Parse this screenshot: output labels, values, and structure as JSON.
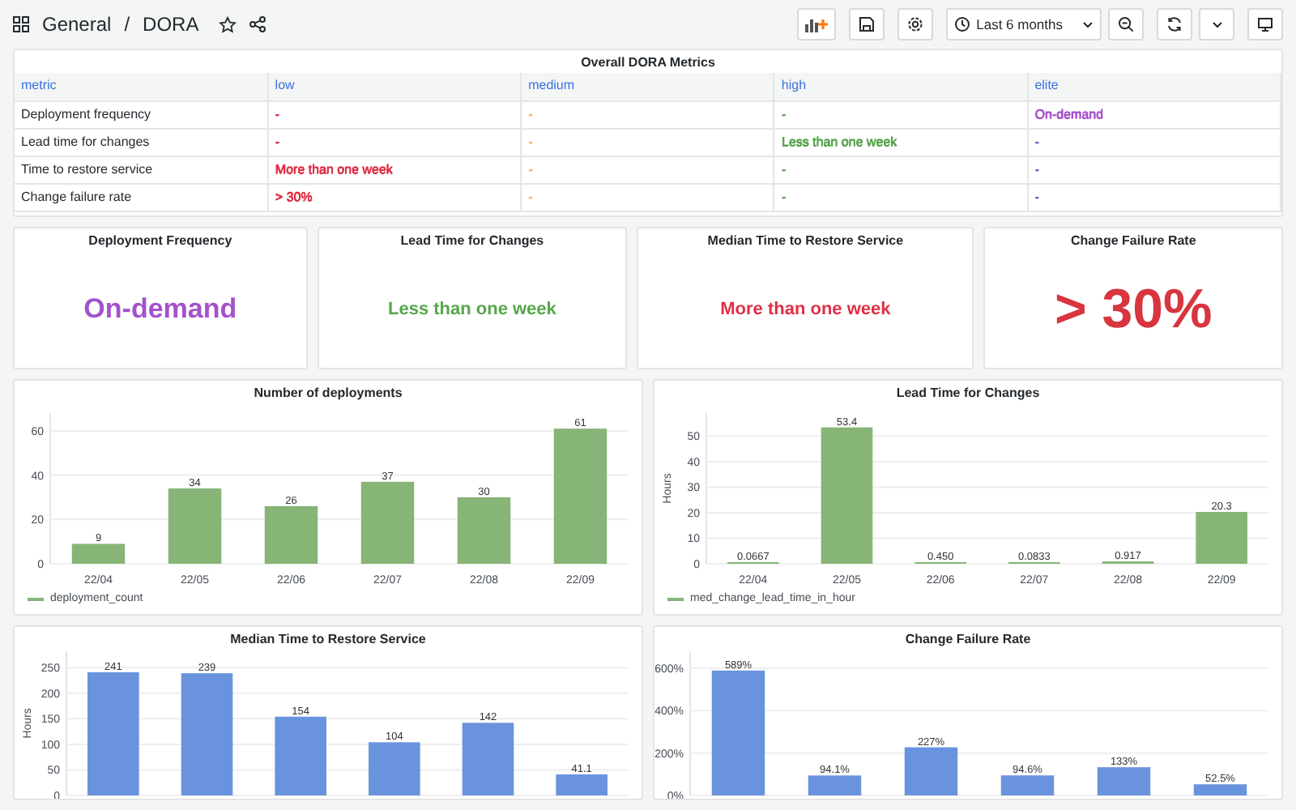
{
  "breadcrumb": {
    "folder": "General",
    "separator": "/",
    "dashboard": "DORA"
  },
  "toolbar": {
    "time_range": "Last 6 months"
  },
  "table_panel": {
    "title": "Overall DORA Metrics",
    "columns": [
      "metric",
      "low",
      "medium",
      "high",
      "elite"
    ],
    "rows": [
      {
        "cells": [
          {
            "text": "Deployment frequency"
          },
          {
            "text": "-",
            "color": "#e02f44"
          },
          {
            "text": "-",
            "color": "#f5b73d"
          },
          {
            "text": "-",
            "color": "#56a64b"
          },
          {
            "text": "On-demand",
            "color": "#a352cc"
          }
        ]
      },
      {
        "cells": [
          {
            "text": "Lead time for changes"
          },
          {
            "text": "-",
            "color": "#e02f44"
          },
          {
            "text": "-",
            "color": "#f5b73d"
          },
          {
            "text": "Less than one week",
            "color": "#56a64b"
          },
          {
            "text": "-",
            "color": "#6a5fd6"
          }
        ]
      },
      {
        "cells": [
          {
            "text": "Time to restore service"
          },
          {
            "text": "More than one week",
            "color": "#e02f44"
          },
          {
            "text": "-",
            "color": "#f5b73d"
          },
          {
            "text": "-",
            "color": "#56a64b"
          },
          {
            "text": "-",
            "color": "#6a5fd6"
          }
        ]
      },
      {
        "cells": [
          {
            "text": "Change failure rate"
          },
          {
            "text": "> 30%",
            "color": "#e02f44"
          },
          {
            "text": "-",
            "color": "#f5b73d"
          },
          {
            "text": "-",
            "color": "#56a64b"
          },
          {
            "text": "-",
            "color": "#6a5fd6"
          }
        ]
      }
    ]
  },
  "stats": [
    {
      "title": "Deployment Frequency",
      "value": "On-demand",
      "color": "#a352cc"
    },
    {
      "title": "Lead Time for Changes",
      "value": "Less than one week",
      "color": "#56a64b"
    },
    {
      "title": "Median Time to Restore Service",
      "value": "More than one week",
      "color": "#e02f44"
    },
    {
      "title": "Change Failure Rate",
      "value": "> 30%",
      "color": "#d8353f"
    }
  ],
  "charts": [
    {
      "chart_data": {
        "type": "bar",
        "title": "Number of deployments",
        "categories": [
          "22/04",
          "22/05",
          "22/06",
          "22/07",
          "22/08",
          "22/09"
        ],
        "series": [
          {
            "name": "deployment_count",
            "color": "#86b577",
            "values": [
              9,
              34,
              26,
              37,
              30,
              61
            ]
          }
        ],
        "grid": true,
        "ylim": [
          0,
          68
        ],
        "yticks": [
          0,
          20,
          40,
          60
        ],
        "value_labels": [
          "9",
          "34",
          "26",
          "37",
          "30",
          "61"
        ]
      }
    },
    {
      "chart_data": {
        "type": "bar",
        "title": "Lead Time for Changes",
        "ylabel": "Hours",
        "categories": [
          "22/04",
          "22/05",
          "22/06",
          "22/07",
          "22/08",
          "22/09"
        ],
        "series": [
          {
            "name": "med_change_lead_time_in_hour",
            "color": "#86b577",
            "values": [
              0.0667,
              53.4,
              0.45,
              0.0833,
              0.917,
              20.3
            ]
          }
        ],
        "grid": true,
        "ylim": [
          0,
          59
        ],
        "yticks": [
          0,
          10,
          20,
          30,
          40,
          50
        ],
        "value_labels": [
          "0.0667",
          "53.4",
          "0.450",
          "0.0833",
          "0.917",
          "20.3"
        ]
      }
    },
    {
      "chart_data": {
        "type": "bar",
        "title": "Median Time to Restore Service",
        "ylabel": "Hours",
        "series": [
          {
            "color": "#6a93de",
            "values": [
              241,
              239,
              154,
              104,
              142,
              41.1
            ]
          }
        ],
        "grid": true,
        "ylim": [
          0,
          282
        ],
        "yticks": [
          0,
          50,
          100,
          150,
          200,
          250
        ],
        "value_labels": [
          "241",
          "239",
          "154",
          "104",
          "142",
          "41.1"
        ]
      }
    },
    {
      "chart_data": {
        "type": "bar",
        "title": "Change Failure Rate",
        "series": [
          {
            "color": "#6a93de",
            "values": [
              589,
              94.1,
              227,
              94.6,
              133,
              52.5
            ]
          }
        ],
        "grid": true,
        "ylim": [
          0,
          680
        ],
        "yticks": [
          {
            "value": 0,
            "label": "0%"
          },
          {
            "value": 200,
            "label": "200%"
          },
          {
            "value": 400,
            "label": "400%"
          },
          {
            "value": 600,
            "label": "600%"
          }
        ],
        "value_labels": [
          "589%",
          "94.1%",
          "227%",
          "94.6%",
          "133%",
          "52.5%"
        ]
      }
    }
  ]
}
